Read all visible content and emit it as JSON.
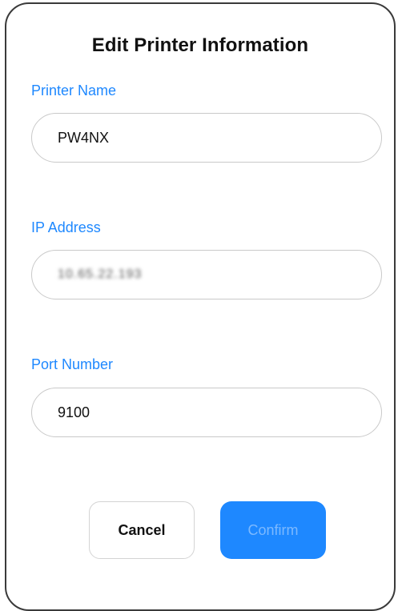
{
  "dialog": {
    "title": "Edit Printer Information",
    "fields": {
      "printer_name": {
        "label": "Printer Name",
        "value": "PW4NX"
      },
      "ip_address": {
        "label": "IP Address",
        "value": "10.65.22.193"
      },
      "port_number": {
        "label": "Port Number",
        "value": "9100"
      }
    },
    "buttons": {
      "cancel": "Cancel",
      "confirm": "Confirm"
    }
  },
  "colors": {
    "accent": "#1e88ff",
    "confirm_text_disabled": "#7cb9ff",
    "border": "#3a3a3a"
  }
}
